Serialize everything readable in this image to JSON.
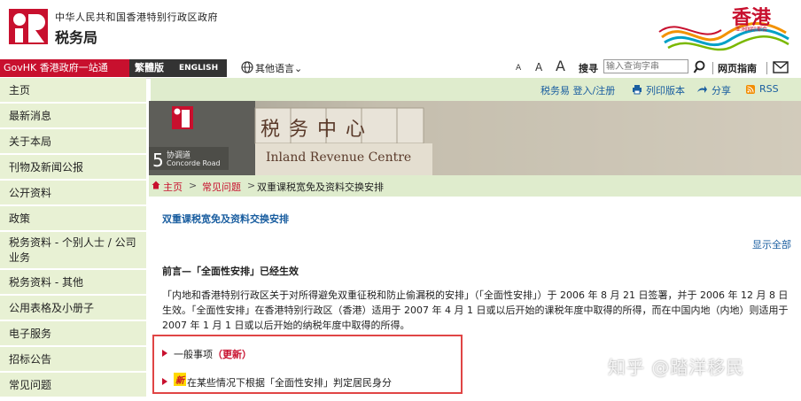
{
  "header": {
    "dept_full": "中华人民共和国香港特别行政区政府",
    "dept_name": "税务局",
    "brand_text": "香港",
    "brand_sub": "亚洲国际都会"
  },
  "toolbar": {
    "govhk": "GovHK 香港政府一站通",
    "lang_trad": "繁體版",
    "lang_en": "ENGLISH",
    "other_lang": "其他语言",
    "font_small": "A",
    "font_medium": "A",
    "font_large": "A",
    "search_label": "搜寻",
    "search_placeholder": "输入查询字串",
    "sitemap": "网页指南"
  },
  "sidebar": {
    "items": [
      {
        "label": "主页"
      },
      {
        "label": "最新消息"
      },
      {
        "label": "关于本局"
      },
      {
        "label": "刊物及新闻公报"
      },
      {
        "label": "公开资料"
      },
      {
        "label": "政策"
      },
      {
        "label": "税务资料 - 个别人士 / 公司业务"
      },
      {
        "label": "税务资料 - 其他"
      },
      {
        "label": "公用表格及小册子"
      },
      {
        "label": "电子服务"
      },
      {
        "label": "招标公告"
      },
      {
        "label": "常见问题"
      }
    ]
  },
  "util": {
    "login": "税务易 登入/注册",
    "print": "列印版本",
    "share": "分享",
    "rss": "RSS"
  },
  "banner": {
    "sign_cn": "税务中心",
    "sign_en": "Inland Revenue Centre",
    "address_num": "5",
    "address_cn": "协调道",
    "address_en": "Concorde Road"
  },
  "breadcrumb": {
    "home": "主页",
    "sep": ">",
    "faq": "常见问题",
    "current": "双重课税宽免及资料交换安排"
  },
  "main": {
    "title": "双重课税宽免及资料交换安排",
    "show_all": "显示全部",
    "section_heading": "前言—「全面性安排」已经生效",
    "intro": "「内地和香港特别行政区关于对所得避免双重征税和防止偷漏税的安排」（「全面性安排」）于 2006 年 8 月 21 日签署，并于 2006 年 12 月 8 日生效。「全面性安排」在香港特别行政区（香港）适用于 2007 年 4 月 1 日或以后开始的课税年度中取得的所得，而在中国内地（内地）则适用于 2007 年 1 月 1 日或以后开始的纳税年度中取得的所得。",
    "item1_label": "一般事项",
    "item1_update": "（更新）",
    "item2_badge": "新",
    "item2_label": "在某些情况下根据「全面性安排」判定居民身分"
  },
  "watermark": "知乎 @踏洋移民",
  "colors": {
    "brand_red": "#c8102e",
    "sidebar_green": "#e8f1d4",
    "bar_green": "#dfeccd",
    "link_blue": "#1a5ea0",
    "highlight_red": "#e04545"
  }
}
